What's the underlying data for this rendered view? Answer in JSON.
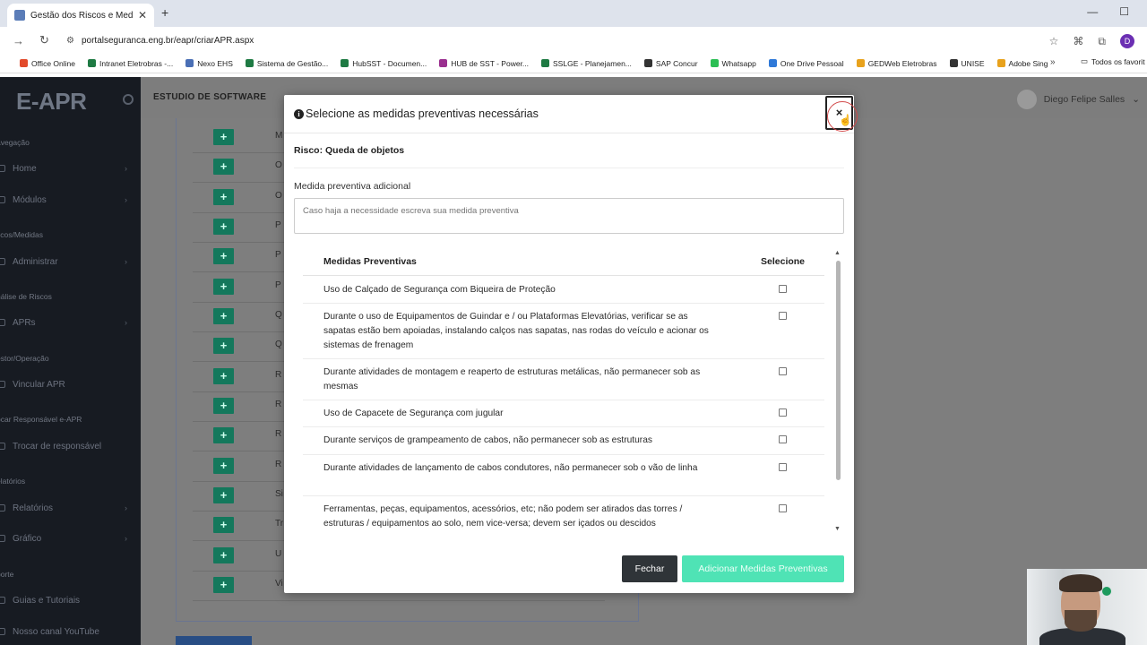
{
  "browser": {
    "tab_title": "Gestão dos Riscos e Medidas P",
    "tab_close": "✕",
    "new_tab": "+",
    "url": "portalseguranca.eng.br/eapr/criarAPR.aspx",
    "bookmarks": [
      {
        "label": "Office Online",
        "color": "#e24a2b"
      },
      {
        "label": "Intranet Eletrobras -...",
        "color": "#1e7a43"
      },
      {
        "label": "Nexo EHS",
        "color": "#4a6fb5"
      },
      {
        "label": "Sistema de Gestão...",
        "color": "#1e7a43"
      },
      {
        "label": "HubSST - Documen...",
        "color": "#1e7a43"
      },
      {
        "label": "HUB de SST - Power...",
        "color": "#9a2f8f"
      },
      {
        "label": "SSLGE - Planejamen...",
        "color": "#1e7a43"
      },
      {
        "label": "SAP Concur",
        "color": "#333333"
      },
      {
        "label": "Whatsapp",
        "color": "#2bbf54"
      },
      {
        "label": "One Drive Pessoal",
        "color": "#2f79d8"
      },
      {
        "label": "GEDWeb Eletrobras",
        "color": "#e8a21c"
      },
      {
        "label": "UNISE",
        "color": "#333333"
      },
      {
        "label": "Adobe Sing",
        "color": "#e8a21c"
      }
    ],
    "bookmarks_more": "»",
    "bookmarks_folder": "Todos os favorit",
    "profile_initial": "D"
  },
  "app": {
    "logo": "E-APR",
    "top_title": "ESTUDIO DE SOFTWARE",
    "user_name": "Diego Felipe Salles",
    "sidebar": {
      "sections": [
        {
          "label": "avegação"
        },
        {
          "label": "scos/Medidas"
        },
        {
          "label": "nálise de Riscos"
        },
        {
          "label": "estor/Operação"
        },
        {
          "label": "ocar Responsável e-APR"
        },
        {
          "label": "elatórios"
        },
        {
          "label": "porte"
        }
      ],
      "items": [
        {
          "label": "Home"
        },
        {
          "label": "Módulos"
        },
        {
          "label": "Administrar"
        },
        {
          "label": "APRs"
        },
        {
          "label": "Vincular APR"
        },
        {
          "label": "Trocar de responsável"
        },
        {
          "label": "Relatórios"
        },
        {
          "label": "Gráfico"
        },
        {
          "label": "Guias e Tutoriais"
        },
        {
          "label": "Nosso canal YouTube"
        }
      ]
    },
    "list_rows": [
      "M",
      "O",
      "O",
      "P",
      "P",
      "P",
      "Q",
      "Q",
      "R",
      "R",
      "R",
      "R",
      "Si",
      "Tr",
      "U",
      "Vi"
    ],
    "row_button_label": "+"
  },
  "modal": {
    "title": "Selecione as medidas preventivas necessárias",
    "close_label": "×",
    "risk_text": "Risco: Queda de objetos",
    "additional_label": "Medida preventiva adicional",
    "additional_placeholder": "Caso haja a necessidade escreva sua medida preventiva",
    "table": {
      "col_measures": "Medidas Preventivas",
      "col_select": "Selecione",
      "rows": [
        {
          "text": "Uso de Calçado de Segurança com Biqueira de Proteção",
          "checked": false
        },
        {
          "text": "Durante o uso de Equipamentos de Guindar e / ou Plataformas Elevatórias, verificar se as sapatas estão bem apoiadas, instalando calços nas sapatas, nas rodas do veículo e acionar os sistemas de frenagem",
          "checked": false
        },
        {
          "text": "Durante atividades de montagem e reaperto de estruturas metálicas, não permanecer sob as mesmas",
          "checked": false
        },
        {
          "text": "Uso de Capacete de Segurança com jugular",
          "checked": false
        },
        {
          "text": "Durante serviços de grampeamento de cabos, não permanecer sob as estruturas",
          "checked": false
        },
        {
          "text": "Durante atividades de lançamento de cabos condutores, não permanecer sob o vão de linha",
          "checked": false
        },
        {
          "text": "Ferramentas, peças, equipamentos, acessórios, etc; não podem ser atirados das torres / estruturas / equipamentos ao solo, nem vice-versa; devem ser içados ou descidos",
          "checked": false
        }
      ]
    },
    "btn_close": "Fechar",
    "btn_add": "Adicionar Medidas Preventivas"
  }
}
